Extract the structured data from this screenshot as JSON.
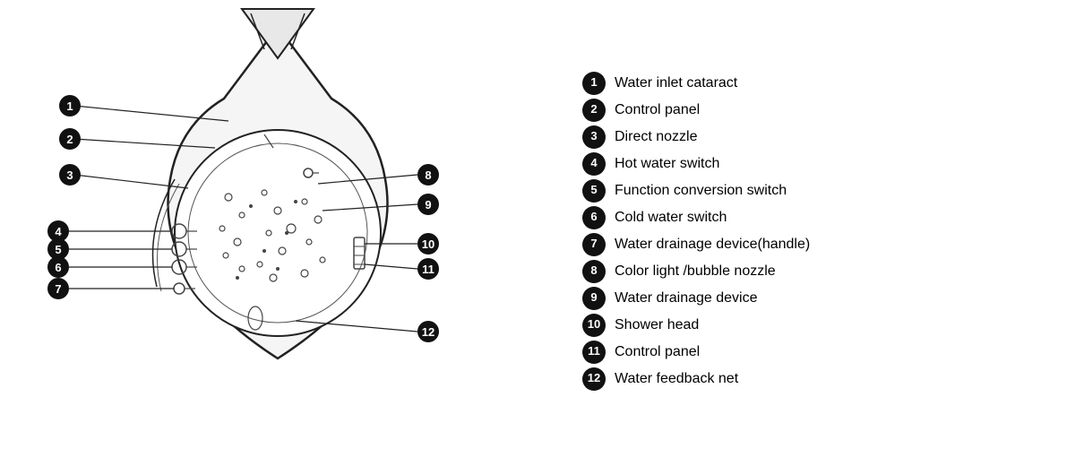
{
  "legend": {
    "items": [
      {
        "number": "1",
        "label": "Water inlet cataract"
      },
      {
        "number": "2",
        "label": "Control panel"
      },
      {
        "number": "3",
        "label": "Direct nozzle"
      },
      {
        "number": "4",
        "label": "Hot water switch"
      },
      {
        "number": "5",
        "label": "Function conversion switch"
      },
      {
        "number": "6",
        "label": "Cold water switch"
      },
      {
        "number": "7",
        "label": "Water drainage device(handle)"
      },
      {
        "number": "8",
        "label": "Color light /bubble nozzle"
      },
      {
        "number": "9",
        "label": "Water drainage device"
      },
      {
        "number": "10",
        "label": "Shower head"
      },
      {
        "number": "11",
        "label": "Control panel"
      },
      {
        "number": "12",
        "label": "Water feedback net"
      }
    ]
  }
}
